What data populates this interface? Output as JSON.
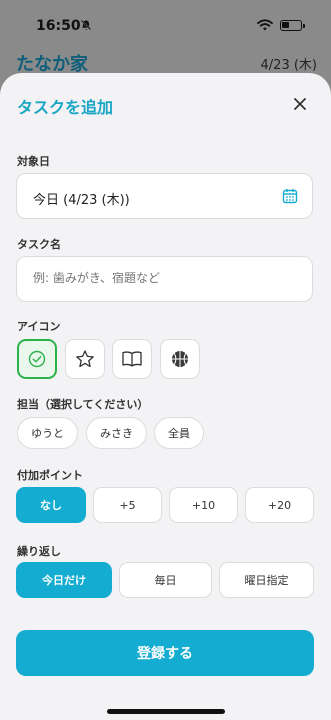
{
  "status_bar": {
    "time": "16:50"
  },
  "background": {
    "title": "たなか家",
    "date": "4/23 (木)"
  },
  "sheet": {
    "title": "タスクを追加",
    "date_label": "対象日",
    "date_value": "今日 (4/23 (木))",
    "task_label": "タスク名",
    "task_placeholder": "例: 歯みがき、宿題など",
    "icon_label": "アイコン",
    "icons": [
      "check-circle-icon",
      "star-icon",
      "book-icon",
      "basketball-icon"
    ],
    "assignee_label": "担当（選択してください）",
    "assignees": [
      "ゆうと",
      "みさき",
      "全員"
    ],
    "points_label": "付加ポイント",
    "points": [
      "なし",
      "+5",
      "+10",
      "+20"
    ],
    "repeat_label": "繰り返し",
    "repeat": [
      "今日だけ",
      "毎日",
      "曜日指定"
    ],
    "submit_label": "登録する"
  },
  "colors": {
    "accent": "#14acd0",
    "selected_icon": "#2bb24a"
  }
}
